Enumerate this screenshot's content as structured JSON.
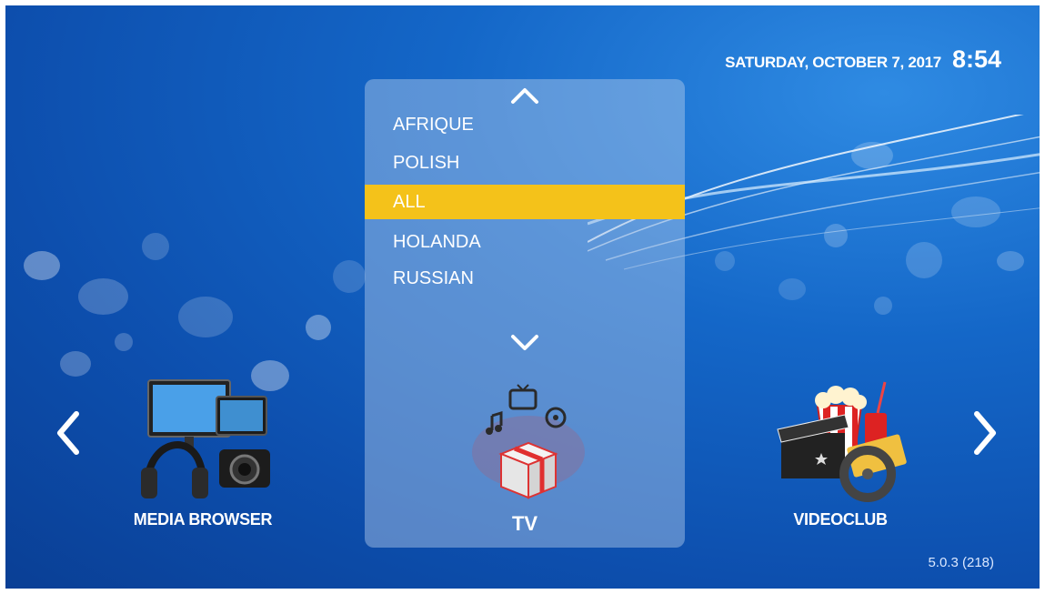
{
  "header": {
    "date": "SATURDAY, OCTOBER 7, 2017",
    "time": "8:54"
  },
  "category_menu": {
    "items": [
      {
        "label": "AFRIQUE",
        "selected": false
      },
      {
        "label": "POLISH",
        "selected": false
      },
      {
        "label": "ALL",
        "selected": true
      },
      {
        "label": "HOLANDA",
        "selected": false
      },
      {
        "label": "RUSSIAN",
        "selected": false
      }
    ],
    "highlight_color": "#f4c21a"
  },
  "tiles": {
    "left": {
      "label": "MEDIA BROWSER",
      "icon": "media-devices-icon"
    },
    "center": {
      "label": "TV",
      "icon": "tv-gift-box-icon"
    },
    "right": {
      "label": "VIDEOCLUB",
      "icon": "cinema-popcorn-icon"
    }
  },
  "navigation": {
    "prev_icon": "chevron-left-icon",
    "next_icon": "chevron-right-icon"
  },
  "version": "5.0.3 (218)"
}
